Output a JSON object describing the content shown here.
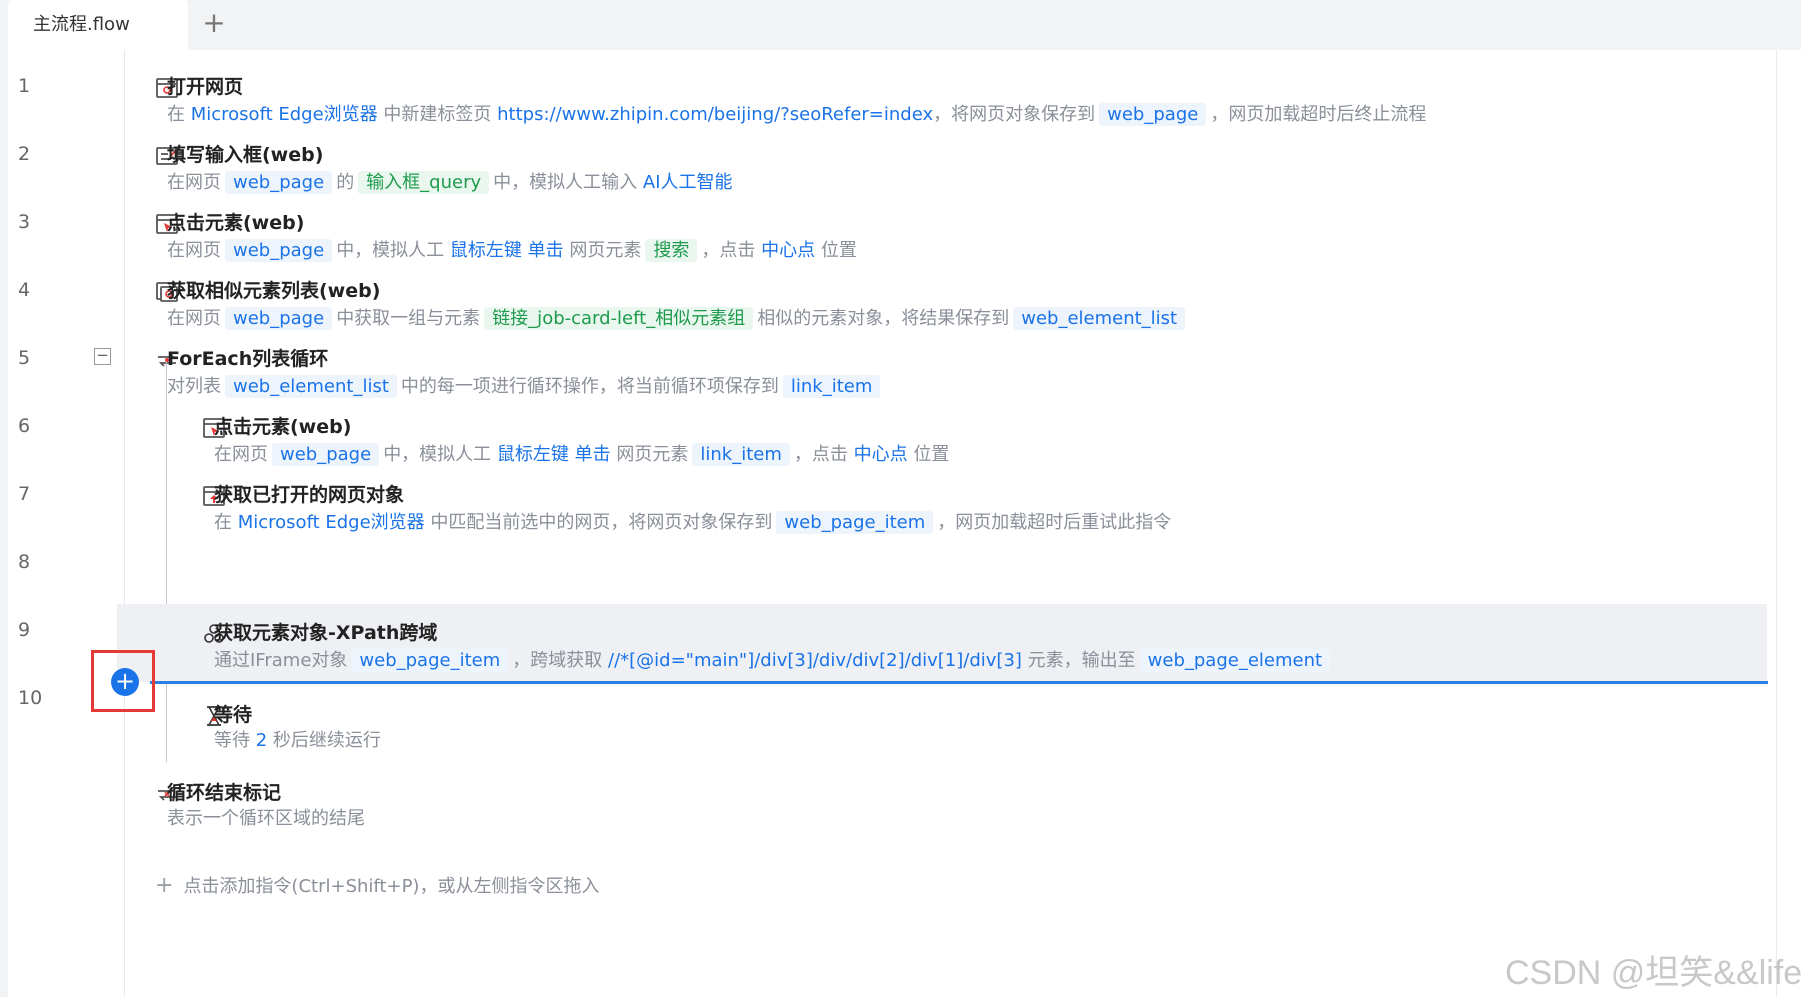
{
  "tab": {
    "label": "主流程.flow",
    "add_label": "+"
  },
  "line_numbers": [
    "1",
    "2",
    "3",
    "4",
    "5",
    "6",
    "7",
    "8",
    "9",
    "10"
  ],
  "steps": [
    {
      "title": "打开网页",
      "desc": [
        [
          "t",
          "在 "
        ],
        [
          "k",
          "Microsoft Edge浏览器"
        ],
        [
          "t",
          " 中新建标签页 "
        ],
        [
          "k",
          "https://www.zhipin.com/beijing/?seoRefer=index"
        ],
        [
          "t",
          "，将网页对象保存到"
        ],
        [
          "v",
          "web_page"
        ],
        [
          "t",
          "，网页加载超时后终止流程"
        ]
      ]
    },
    {
      "title": "填写输入框(web)",
      "desc": [
        [
          "t",
          "在网页"
        ],
        [
          "v",
          "web_page"
        ],
        [
          "t",
          "的"
        ],
        [
          "e",
          "输入框_query"
        ],
        [
          "t",
          "中，模拟人工输入 "
        ],
        [
          "k",
          "AI人工智能"
        ]
      ]
    },
    {
      "title": "点击元素(web)",
      "desc": [
        [
          "t",
          "在网页"
        ],
        [
          "v",
          "web_page"
        ],
        [
          "t",
          "中，模拟人工 "
        ],
        [
          "k",
          "鼠标左键"
        ],
        [
          "t",
          " "
        ],
        [
          "k",
          "单击"
        ],
        [
          "t",
          " 网页元素"
        ],
        [
          "e",
          "搜索"
        ],
        [
          "t",
          "，点击 "
        ],
        [
          "k",
          "中心点"
        ],
        [
          "t",
          " 位置"
        ]
      ]
    },
    {
      "title": "获取相似元素列表(web)",
      "desc": [
        [
          "t",
          "在网页"
        ],
        [
          "v",
          "web_page"
        ],
        [
          "t",
          "中获取一组与元素"
        ],
        [
          "e",
          "链接_job-card-left_相似元素组"
        ],
        [
          "t",
          "相似的元素对象，将结果保存到"
        ],
        [
          "v",
          "web_element_list"
        ]
      ]
    },
    {
      "title": "ForEach列表循环",
      "desc": [
        [
          "t",
          "对列表"
        ],
        [
          "v",
          "web_element_list"
        ],
        [
          "t",
          "中的每一项进行循环操作，将当前循环项保存到"
        ],
        [
          "v",
          "link_item"
        ]
      ]
    },
    {
      "title": "点击元素(web)",
      "desc": [
        [
          "t",
          "在网页"
        ],
        [
          "v",
          "web_page"
        ],
        [
          "t",
          "中，模拟人工 "
        ],
        [
          "k",
          "鼠标左键"
        ],
        [
          "t",
          " "
        ],
        [
          "k",
          "单击"
        ],
        [
          "t",
          " 网页元素"
        ],
        [
          "v",
          "link_item"
        ],
        [
          "t",
          "，点击 "
        ],
        [
          "k",
          "中心点"
        ],
        [
          "t",
          " 位置"
        ]
      ]
    },
    {
      "title": "获取已打开的网页对象",
      "desc": [
        [
          "t",
          "在 "
        ],
        [
          "k",
          "Microsoft Edge浏览器"
        ],
        [
          "t",
          " 中匹配当前选中的网页，将网页对象保存到"
        ],
        [
          "v",
          "web_page_item"
        ],
        [
          "t",
          "，网页加载超时后重试此指令"
        ]
      ]
    },
    {
      "title": "获取元素对象-XPath跨域",
      "desc": [
        [
          "t",
          "通过IFrame对象"
        ],
        [
          "v",
          "web_page_item"
        ],
        [
          "t",
          "，跨域获取 "
        ],
        [
          "k",
          "//*[@id=\"main\"]/div[3]/div/div[2]/div[1]/div[3]"
        ],
        [
          "t",
          " 元素，输出至"
        ],
        [
          "v",
          "web_page_element"
        ]
      ]
    },
    {
      "title": "等待",
      "desc": [
        [
          "t",
          "等待 "
        ],
        [
          "k",
          "2"
        ],
        [
          "t",
          " 秒后继续运行"
        ]
      ]
    },
    {
      "title": "循环结束标记",
      "desc": [
        [
          "t",
          "表示一个循环区域的结尾"
        ]
      ]
    }
  ],
  "add_hint": "点击添加指令(Ctrl+Shift+P)，或从左侧指令区拖入",
  "watermark": "CSDN @坦笑&&life",
  "colors": {
    "accent": "#1a73e8",
    "element": "#1f9b4e",
    "highlight": "#e53935"
  }
}
